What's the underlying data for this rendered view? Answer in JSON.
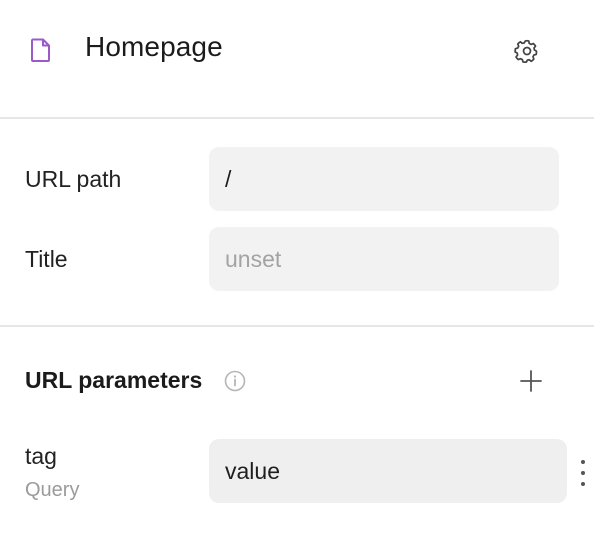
{
  "header": {
    "title": "Homepage",
    "page_icon": "document-icon",
    "settings_icon": "gear-icon"
  },
  "fields": {
    "url_path": {
      "label": "URL path",
      "value": "/"
    },
    "title": {
      "label": "Title",
      "value": "",
      "placeholder": "unset"
    }
  },
  "url_parameters": {
    "title": "URL parameters",
    "info_icon": "info-icon",
    "add_icon": "plus-icon",
    "items": [
      {
        "name": "tag",
        "type": "Query",
        "value": "value"
      }
    ]
  },
  "colors": {
    "accent": "#9b59c9",
    "input_bg": "#f2f2f2",
    "divider": "#e6e6e6",
    "muted_text": "#9b9b9b"
  }
}
